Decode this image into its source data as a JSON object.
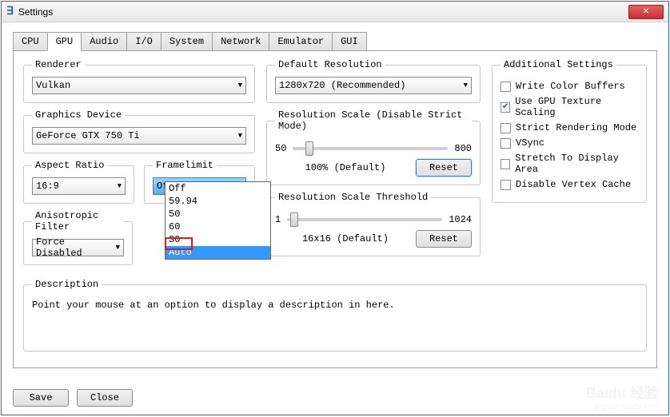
{
  "window": {
    "title": "Settings"
  },
  "tabs": [
    "CPU",
    "GPU",
    "Audio",
    "I/O",
    "System",
    "Network",
    "Emulator",
    "GUI"
  ],
  "active_tab": "GPU",
  "renderer": {
    "legend": "Renderer",
    "value": "Vulkan"
  },
  "graphics_device": {
    "legend": "Graphics Device",
    "value": "GeForce GTX 750 Ti"
  },
  "aspect_ratio": {
    "legend": "Aspect Ratio",
    "value": "16:9"
  },
  "framelimit": {
    "legend": "Framelimit",
    "value": "Off",
    "options": [
      "Off",
      "59.94",
      "50",
      "60",
      "30",
      "Auto"
    ],
    "highlighted": "Auto"
  },
  "anisotropic_filter": {
    "legend": "Anisotropic Filter",
    "value": "Force Disabled"
  },
  "default_resolution": {
    "legend": "Default Resolution",
    "value": "1280x720 (Recommended)"
  },
  "resolution_scale": {
    "legend": "Resolution Scale (Disable Strict Mode)",
    "min": "50",
    "max": "800",
    "label": "100% (Default)",
    "reset": "Reset"
  },
  "resolution_scale_threshold": {
    "legend": "Resolution Scale Threshold",
    "min": "1",
    "max": "1024",
    "label": "16x16 (Default)",
    "reset": "Reset"
  },
  "additional_settings": {
    "legend": "Additional Settings",
    "items": [
      {
        "label": "Write Color Buffers",
        "checked": false
      },
      {
        "label": "Use GPU Texture Scaling",
        "checked": true
      },
      {
        "label": "Strict Rendering Mode",
        "checked": false
      },
      {
        "label": "VSync",
        "checked": false
      },
      {
        "label": "Stretch To Display Area",
        "checked": false
      },
      {
        "label": "Disable Vertex Cache",
        "checked": false
      }
    ]
  },
  "description": {
    "legend": "Description",
    "text": "Point your mouse at an option to display a description in here."
  },
  "footer": {
    "save": "Save",
    "close": "Close"
  },
  "watermark": {
    "brand": "Baidu 经验",
    "sub": "jingyan.baidu.com"
  }
}
